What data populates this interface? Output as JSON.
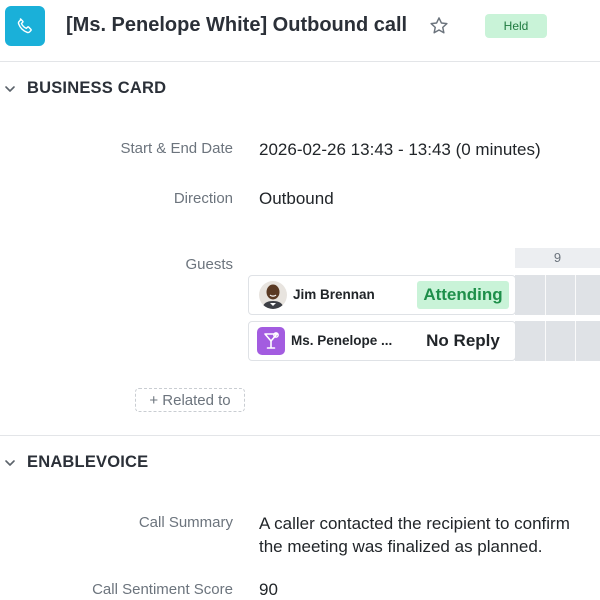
{
  "header": {
    "title": "[Ms. Penelope White] Outbound call",
    "status_badge": "Held",
    "icon": "phone-icon"
  },
  "sections": [
    {
      "title": "BUSINESS CARD"
    },
    {
      "title": "ENABLEVOICE"
    }
  ],
  "business_card": {
    "start_end_label": "Start & End Date",
    "start_end_value": "2026-02-26 13:43 - 13:43 (0 minutes)",
    "direction_label": "Direction",
    "direction_value": "Outbound",
    "guests_label": "Guests",
    "timeline_hour": "9",
    "guests": [
      {
        "name": "Jim Brennan",
        "status": "Attending",
        "status_color": "#1e8f4a",
        "avatar": "person-photo"
      },
      {
        "name": "Ms. Penelope ...",
        "status": "No Reply",
        "status_color": "#212529",
        "avatar": "cocktail-icon"
      }
    ],
    "related_to_label": "+ Related to"
  },
  "enablevoice": {
    "call_summary_label": "Call Summary",
    "call_summary_line1": "A caller contacted the recipient to confirm",
    "call_summary_line2": "the meeting was finalized as planned.",
    "sentiment_label": "Call Sentiment Score",
    "sentiment_value": "90"
  },
  "colors": {
    "accent": "#1ab0d9",
    "held_badge_bg": "#c9f3d8",
    "attending_bg": "#c9f3d8",
    "penelope_avatar_bg": "#a35ce0"
  }
}
